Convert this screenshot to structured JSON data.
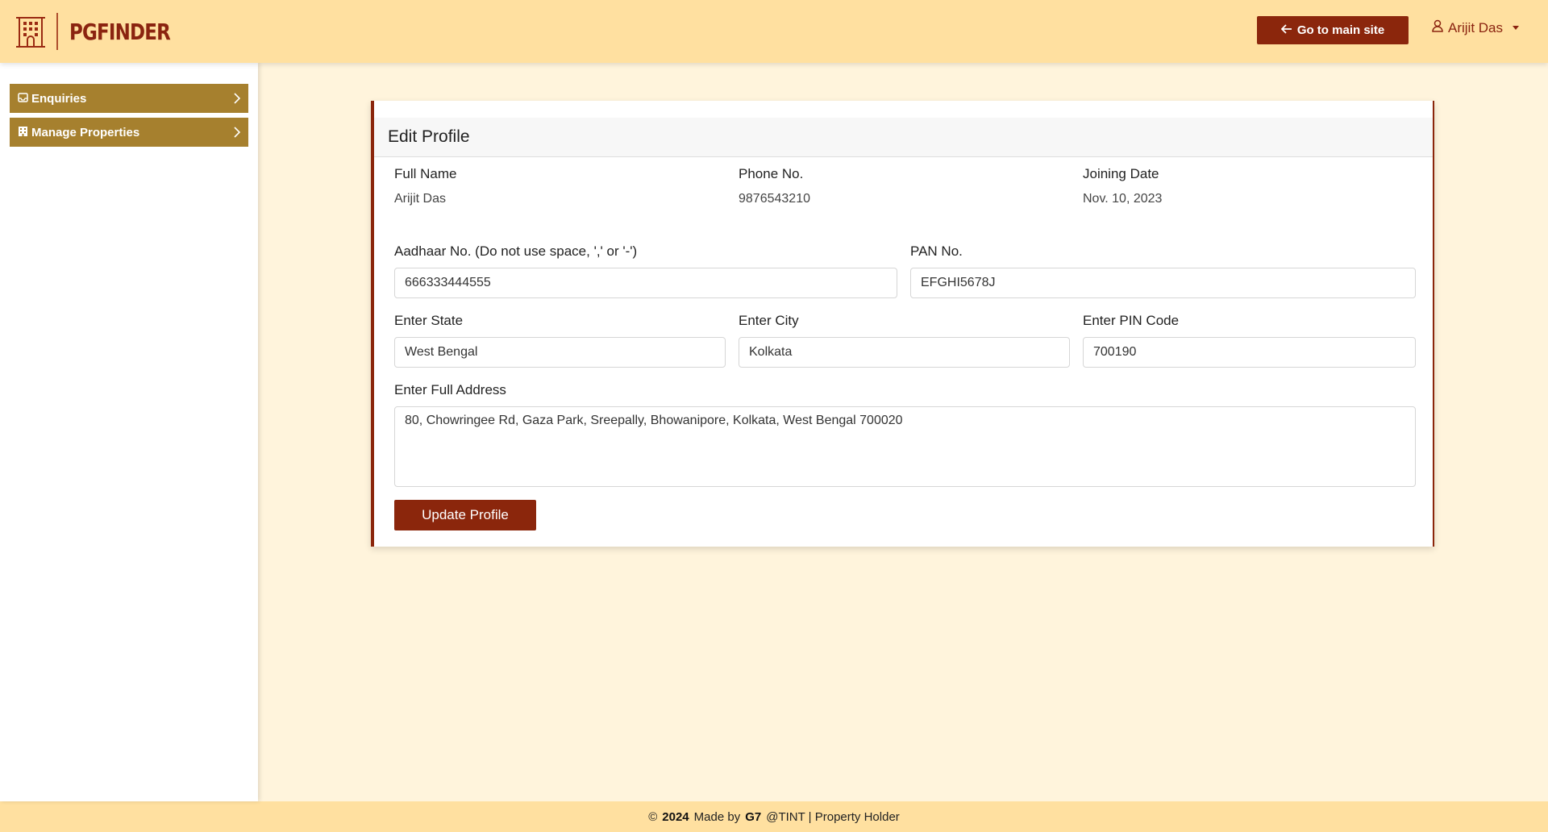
{
  "brand": {
    "name": "PGFINDER",
    "icon": "building-icon"
  },
  "header": {
    "main_site_label": "Go to main site",
    "main_site_icon": "arrow-left-icon",
    "user_name": "Arijit Das",
    "user_icon": "user-icon"
  },
  "sidebar": {
    "items": [
      {
        "label": "Enquiries",
        "icon": "inbox-icon"
      },
      {
        "label": "Manage Properties",
        "icon": "building-icon"
      }
    ]
  },
  "profile": {
    "title": "Edit Profile",
    "full_name_label": "Full Name",
    "full_name": "Arijit Das",
    "phone_label": "Phone No.",
    "phone": "9876543210",
    "joining_label": "Joining Date",
    "joining_date": "Nov. 10, 2023",
    "aadhaar_label": "Aadhaar No. (Do not use space, ',' or '-')",
    "aadhaar": "666333444555",
    "pan_label": "PAN No.",
    "pan": "EFGHI5678J",
    "state_label": "Enter State",
    "state": "West Bengal",
    "city_label": "Enter City",
    "city": "Kolkata",
    "pin_label": "Enter PIN Code",
    "pin": "700190",
    "address_label": "Enter Full Address",
    "address": "80, Chowringee Rd, Gaza Park, Sreepally, Bhowanipore, Kolkata, West Bengal 700020",
    "update_label": "Update Profile"
  },
  "footer": {
    "copyright": "©",
    "year": "2024",
    "made_by": "Made by",
    "team": "G7",
    "rest": "@TINT | Property Holder"
  },
  "colors": {
    "topbar": "#ffe0a0",
    "accent": "#8b260c",
    "sidebar_item": "#a6802e",
    "page_bg": "#fff4dc"
  }
}
